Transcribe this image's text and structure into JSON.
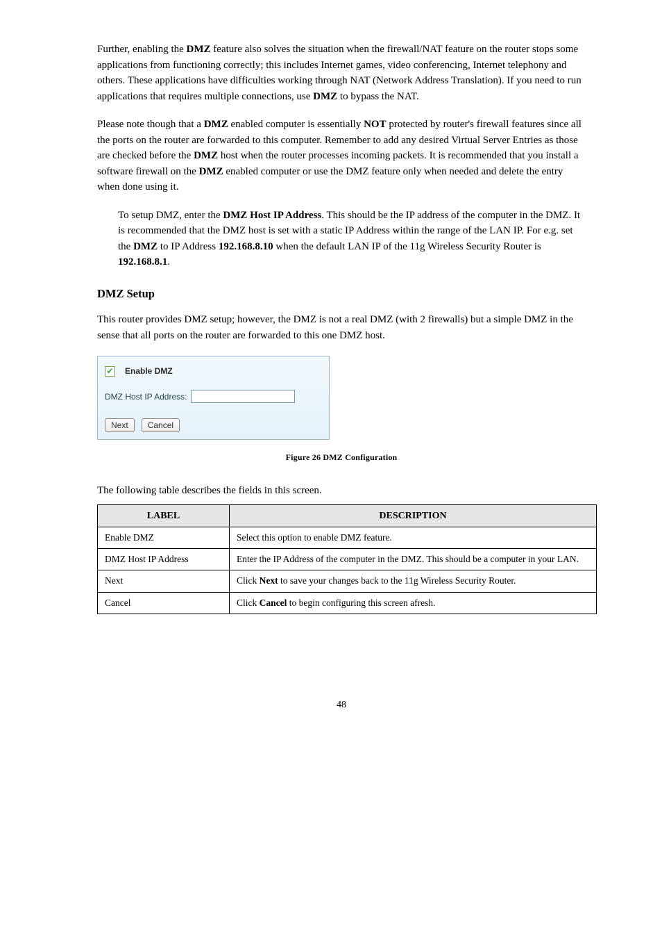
{
  "para1": {
    "prefix": "Further, enabling the ",
    "bold1": "DMZ",
    "mid": " feature also solves the situation when the firewall/NAT feature on the router stops some applications from functioning correctly; this includes Internet games, video conferencing, Internet telephony and others. These applications have difficulties working through NAT (Network Address Translation). If you need to run applications that requires multiple connections, use ",
    "bold2": "DMZ",
    "suffix": " to bypass the NAT."
  },
  "para2": {
    "prefix": "Please note though that a ",
    "bold1": "DMZ",
    "mid1": " enabled computer is essentially ",
    "bold2": "NOT",
    "mid2": " protected by router's firewall features since all the ports on the router are forwarded to this computer. Remember to add any desired Virtual Server Entries as those are checked before the ",
    "bold3": "DMZ",
    "mid3": " host when the router processes incoming packets. It is recommended that you install a software firewall on the ",
    "bold4": "DMZ",
    "suffix": " enabled computer or use the DMZ feature only when needed and delete the entry when done using it."
  },
  "sub1": {
    "prefix": "To setup DMZ, enter the ",
    "bold1": "DMZ Host IP Address",
    "mid1": ". This should be the IP address of the computer in the DMZ. It is recommended that the DMZ host is set with a static IP Address within the range of the LAN IP. For e.g. set the ",
    "bold2": "DMZ",
    "mid2": " to IP Address ",
    "bold3": "192.168.8.10",
    "mid3": " when the default LAN IP of the 11g Wireless Security Router is ",
    "bold4": "192.168.8.1",
    "suffix": "."
  },
  "heading": "DMZ Setup",
  "desc": "This router provides DMZ setup; however, the DMZ is not a real DMZ (with 2 firewalls) but a simple DMZ in the sense that all ports on the router are forwarded to this one DMZ host.",
  "panel": {
    "enable_label": "Enable DMZ",
    "ip_label": "DMZ Host IP Address:",
    "next": "Next",
    "cancel": "Cancel"
  },
  "caption": "Figure 26 DMZ Configuration",
  "table_intro": "The following table describes the fields in this screen.",
  "table": {
    "h1": "LABEL",
    "h2": "DESCRIPTION",
    "r1c1": "Enable DMZ",
    "r1c2": "Select this option to enable DMZ feature.",
    "r2c1": "DMZ Host IP Address",
    "r2c2": "Enter the IP Address of the computer in the DMZ. This should be a computer in your LAN.",
    "r3c1": "Next",
    "r3c2": {
      "prefix": "Click ",
      "bold": "Next",
      "suffix": " to save your changes back to the 11g Wireless Security Router."
    },
    "r4c1": "Cancel",
    "r4c2": {
      "prefix": "Click ",
      "bold": "Cancel",
      "suffix": " to begin configuring this screen afresh."
    }
  },
  "pagenum": "48"
}
